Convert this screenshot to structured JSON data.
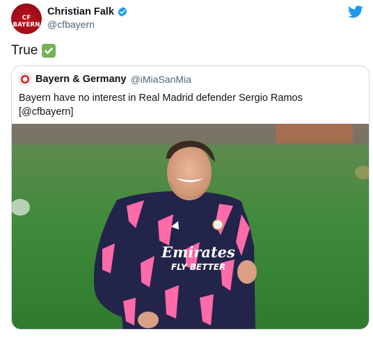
{
  "author": {
    "name": "Christian Falk",
    "handle": "@cfbayern",
    "avatar_text": "CF BAYERN",
    "verified": true
  },
  "tweet": {
    "text": "True",
    "emoji": "check-mark-button"
  },
  "quote": {
    "name": "Bayern & Germany",
    "handle": "@iMiaSanMia",
    "text": "Bayern have no interest in Real Madrid defender Sergio Ramos [@cfbayern]",
    "image": {
      "sponsor": "Emirates",
      "sponsor_sub": "FLY BETTER"
    }
  },
  "colors": {
    "twitter_blue": "#1d9bf0",
    "verified_blue": "#1d9bf0",
    "check_green": "#77b255",
    "pitch_green": "#3f8a3a",
    "shirt_navy": "#22244a",
    "shirt_pink": "#ff6aa8"
  }
}
